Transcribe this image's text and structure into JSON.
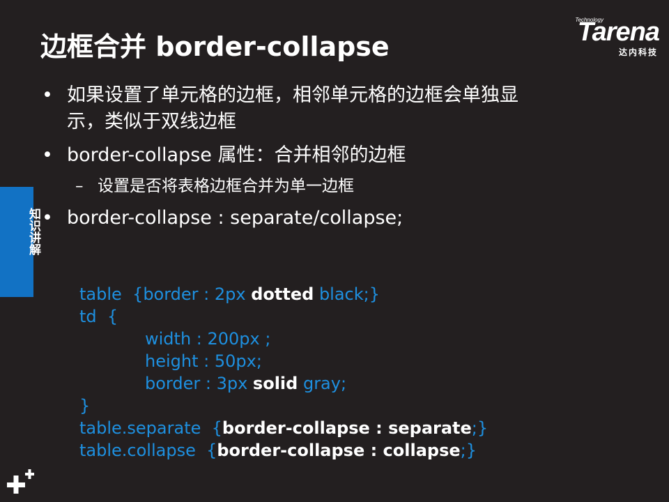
{
  "slide": {
    "title": "边框合并 border-collapse",
    "logo": {
      "technology": "Technology",
      "brand": "Tarena",
      "chinese": "达内科技"
    },
    "side_tab_label": "知识讲解",
    "bullets": [
      {
        "text": "如果设置了单元格的边框，相邻单元格的边框会单独显示，类似于双线边框",
        "line1": "如果设置了单元格的边框，相邻单元格的边框会单独显",
        "line2": "示，类似于双线边框"
      },
      {
        "text": "border-collapse 属性：合并相邻的边框"
      },
      {
        "text": "设置是否将表格边框合并为单一边框"
      },
      {
        "text": "border-collapse : separate/collapse;"
      }
    ],
    "bullet_marker": "•",
    "sub_marker": "–",
    "code": {
      "l1_a": "table  {border : 2px ",
      "l1_b": "dotted",
      "l1_c": " black;}",
      "l2": "td  {",
      "l3": "width : 200px ;",
      "l4": "height : 50px;",
      "l5_a": "border : 3px ",
      "l5_b": "solid",
      "l5_c": " gray;",
      "l6": "}",
      "l7_a": "table.separate  {",
      "l7_b": "border-collapse : separate",
      "l7_c": ";}",
      "l8_a": "table.collapse  {",
      "l8_b": "border-collapse : collapse",
      "l8_c": ";}"
    },
    "colors": {
      "background": "#231f20",
      "accent_blue": "#1272c4",
      "code_blue": "#1e90e0",
      "text": "#ffffff"
    },
    "icons": {
      "corner": "plus-plus-icon"
    }
  }
}
